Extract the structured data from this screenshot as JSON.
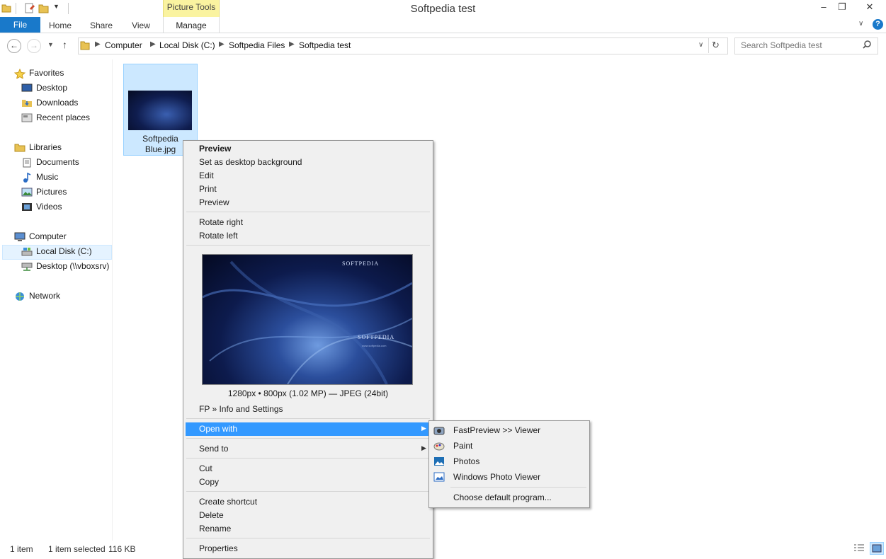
{
  "window": {
    "title": "Softpedia test",
    "contextual_tab": "Picture Tools"
  },
  "ribbon": {
    "tabs": [
      "File",
      "Home",
      "Share",
      "View",
      "Manage"
    ]
  },
  "address": {
    "crumbs": [
      "Computer",
      "Local Disk (C:)",
      "Softpedia Files",
      "Softpedia test"
    ],
    "search_placeholder": "Search Softpedia test"
  },
  "nav": {
    "favorites": "Favorites",
    "favorites_items": [
      "Desktop",
      "Downloads",
      "Recent places"
    ],
    "libraries": "Libraries",
    "libraries_items": [
      "Documents",
      "Music",
      "Pictures",
      "Videos"
    ],
    "computer": "Computer",
    "computer_items": [
      "Local Disk (C:)",
      "Desktop (\\\\vboxsrv)"
    ],
    "network": "Network"
  },
  "file": {
    "name_line1": "Softpedia",
    "name_line2": "Blue.jpg"
  },
  "menu": {
    "preview_bold": "Preview",
    "set_bg": "Set as desktop background",
    "edit": "Edit",
    "print": "Print",
    "preview": "Preview",
    "rotate_right": "Rotate right",
    "rotate_left": "Rotate left",
    "image_info": "1280px • 800px (1.02 MP) — JPEG (24bit)",
    "fp_info": "FP » Info and Settings",
    "open_with": "Open with",
    "send_to": "Send to",
    "cut": "Cut",
    "copy": "Copy",
    "create_shortcut": "Create shortcut",
    "delete": "Delete",
    "rename": "Rename",
    "properties": "Properties"
  },
  "submenu": {
    "fastpreview": "FastPreview >> Viewer",
    "paint": "Paint",
    "photos": "Photos",
    "wpv": "Windows Photo Viewer",
    "choose": "Choose default program..."
  },
  "preview_image_text": {
    "top": "SOFTPEDIA",
    "center": "SOFTPEDIA",
    "url": "www.softpedia.com"
  },
  "status": {
    "count": "1 item",
    "selected": "1 item selected",
    "size": "116 KB"
  },
  "colors": {
    "accent": "#1979ca",
    "selection": "#cce8ff",
    "menu_highlight": "#3399ff",
    "contextual": "#faf3a0"
  }
}
